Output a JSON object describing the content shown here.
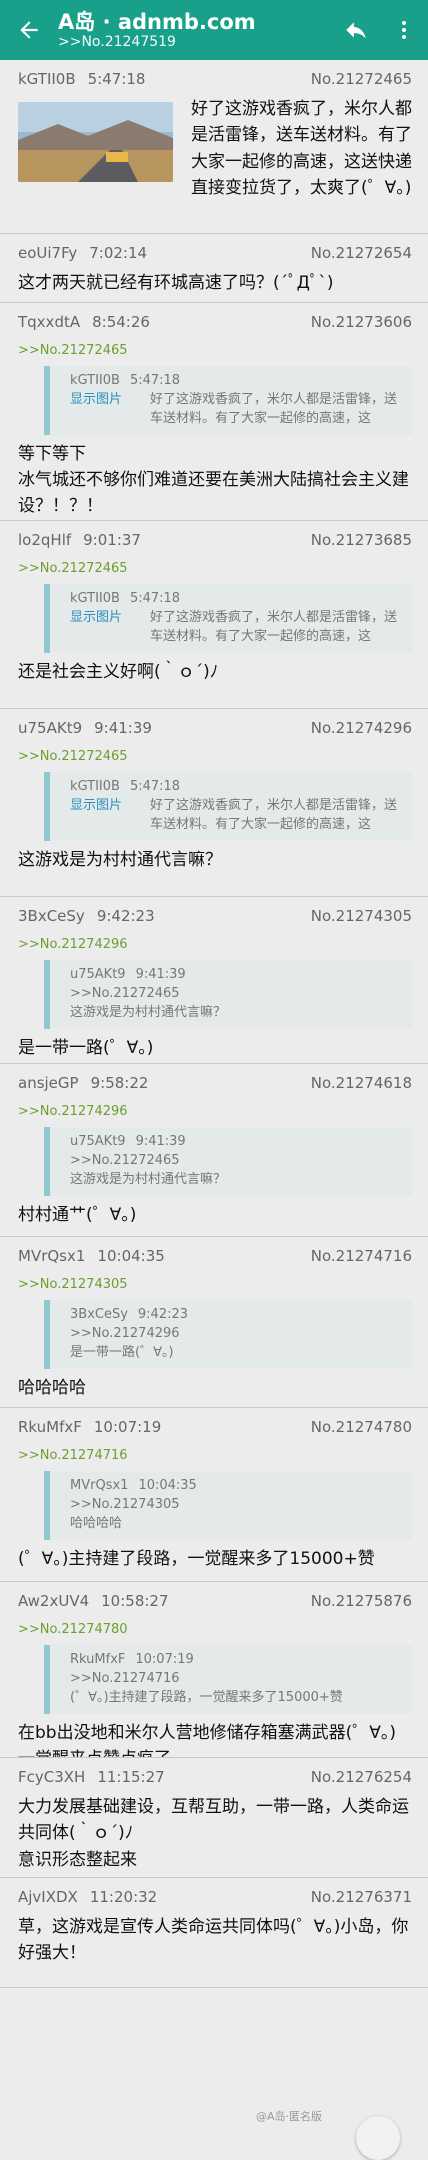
{
  "appbar": {
    "title": "A岛 · adnmb.com",
    "subtitle": ">>No.21247519",
    "icons": [
      "arrow-left-icon",
      "reply-icon",
      "more-vert-icon"
    ]
  },
  "posts": [
    {
      "uid": "kGTII0B",
      "time": "5:47:18",
      "no": "No.21272465",
      "has_image": true,
      "content": "好了这游戏香疯了，米尔人都是活雷锋，送车送材料。有了大家一起修的高速，这送快递直接变拉货了，太爽了(゜∀。)"
    },
    {
      "uid": "eoUi7Fy",
      "time": "7:02:14",
      "no": "No.21272654",
      "content": "这才两天就已经有环城高速了吗？(´ﾟДﾟ`)"
    },
    {
      "uid": "TqxxdtA",
      "time": "8:54:26",
      "no": "No.21273606",
      "ref": ">>No.21272465",
      "quote": {
        "uid": "kGTII0B",
        "time": "5:47:18",
        "show_image": "显示图片",
        "text": "好了这游戏香疯了，米尔人都是活雷锋，送车送材料。有了大家一起修的高速，这"
      },
      "content": "等下等下\n冰气城还不够你们难道还要在美洲大陆搞社会主义建设？！？！"
    },
    {
      "uid": "lo2qHlf",
      "time": "9:01:37",
      "no": "No.21273685",
      "ref": ">>No.21272465",
      "quote": {
        "uid": "kGTII0B",
        "time": "5:47:18",
        "show_image": "显示图片",
        "text": "好了这游戏香疯了，米尔人都是活雷锋，送车送材料。有了大家一起修的高速，这"
      },
      "content": "还是社会主义好啊(｀ｏ´)ﾉ"
    },
    {
      "uid": "u75AKt9",
      "time": "9:41:39",
      "no": "No.21274296",
      "ref": ">>No.21272465",
      "quote": {
        "uid": "kGTII0B",
        "time": "5:47:18",
        "show_image": "显示图片",
        "text": "好了这游戏香疯了，米尔人都是活雷锋，送车送材料。有了大家一起修的高速，这"
      },
      "content": "这游戏是为村村通代言嘛？"
    },
    {
      "uid": "3BxCeSy",
      "time": "9:42:23",
      "no": "No.21274305",
      "ref": ">>No.21274296",
      "quote": {
        "uid": "u75AKt9",
        "time": "9:41:39",
        "text": ">>No.21272465\n这游戏是为村村通代言嘛？"
      },
      "content": "是一带一路(゜∀。)"
    },
    {
      "uid": "ansjeGP",
      "time": "9:58:22",
      "no": "No.21274618",
      "ref": ">>No.21274296",
      "quote": {
        "uid": "u75AKt9",
        "time": "9:41:39",
        "text": ">>No.21272465\n这游戏是为村村通代言嘛？"
      },
      "content": "村村通艹(゜∀。)"
    },
    {
      "uid": "MVrQsx1",
      "time": "10:04:35",
      "no": "No.21274716",
      "ref": ">>No.21274305",
      "quote": {
        "uid": "3BxCeSy",
        "time": "9:42:23",
        "text": ">>No.21274296\n是一带一路(゜∀。)"
      },
      "content": "哈哈哈哈"
    },
    {
      "uid": "RkuMfxF",
      "time": "10:07:19",
      "no": "No.21274780",
      "ref": ">>No.21274716",
      "quote": {
        "uid": "MVrQsx1",
        "time": "10:04:35",
        "text": ">>No.21274305\n哈哈哈哈"
      },
      "content": "(゜∀。)主持建了段路，一觉醒来多了15000+赞"
    },
    {
      "uid": "Aw2xUV4",
      "time": "10:58:27",
      "no": "No.21275876",
      "ref": ">>No.21274780",
      "quote": {
        "uid": "RkuMfxF",
        "time": "10:07:19",
        "text": ">>No.21274716\n(゜∀。)主持建了段路，一觉醒来多了15000+赞"
      },
      "content": "在bb出没地和米尔人营地修储存箱塞满武器(゜∀。)一觉醒来点赞点疯了"
    },
    {
      "uid": "FcyC3XH",
      "time": "11:15:27",
      "no": "No.21276254",
      "content": "大力发展基础建设，互帮互助，一带一路，人类命运共同体(｀ｏ´)ﾉ\n意识形态整起来"
    },
    {
      "uid": "AjvIXDX",
      "time": "11:20:32",
      "no": "No.21276371",
      "content": "草，这游戏是宣传人类命运共同体吗(゜∀。)小岛，你好强大！"
    }
  ],
  "watermark": "@A岛·匿名版",
  "fab_icon": "scroll-top-icon"
}
